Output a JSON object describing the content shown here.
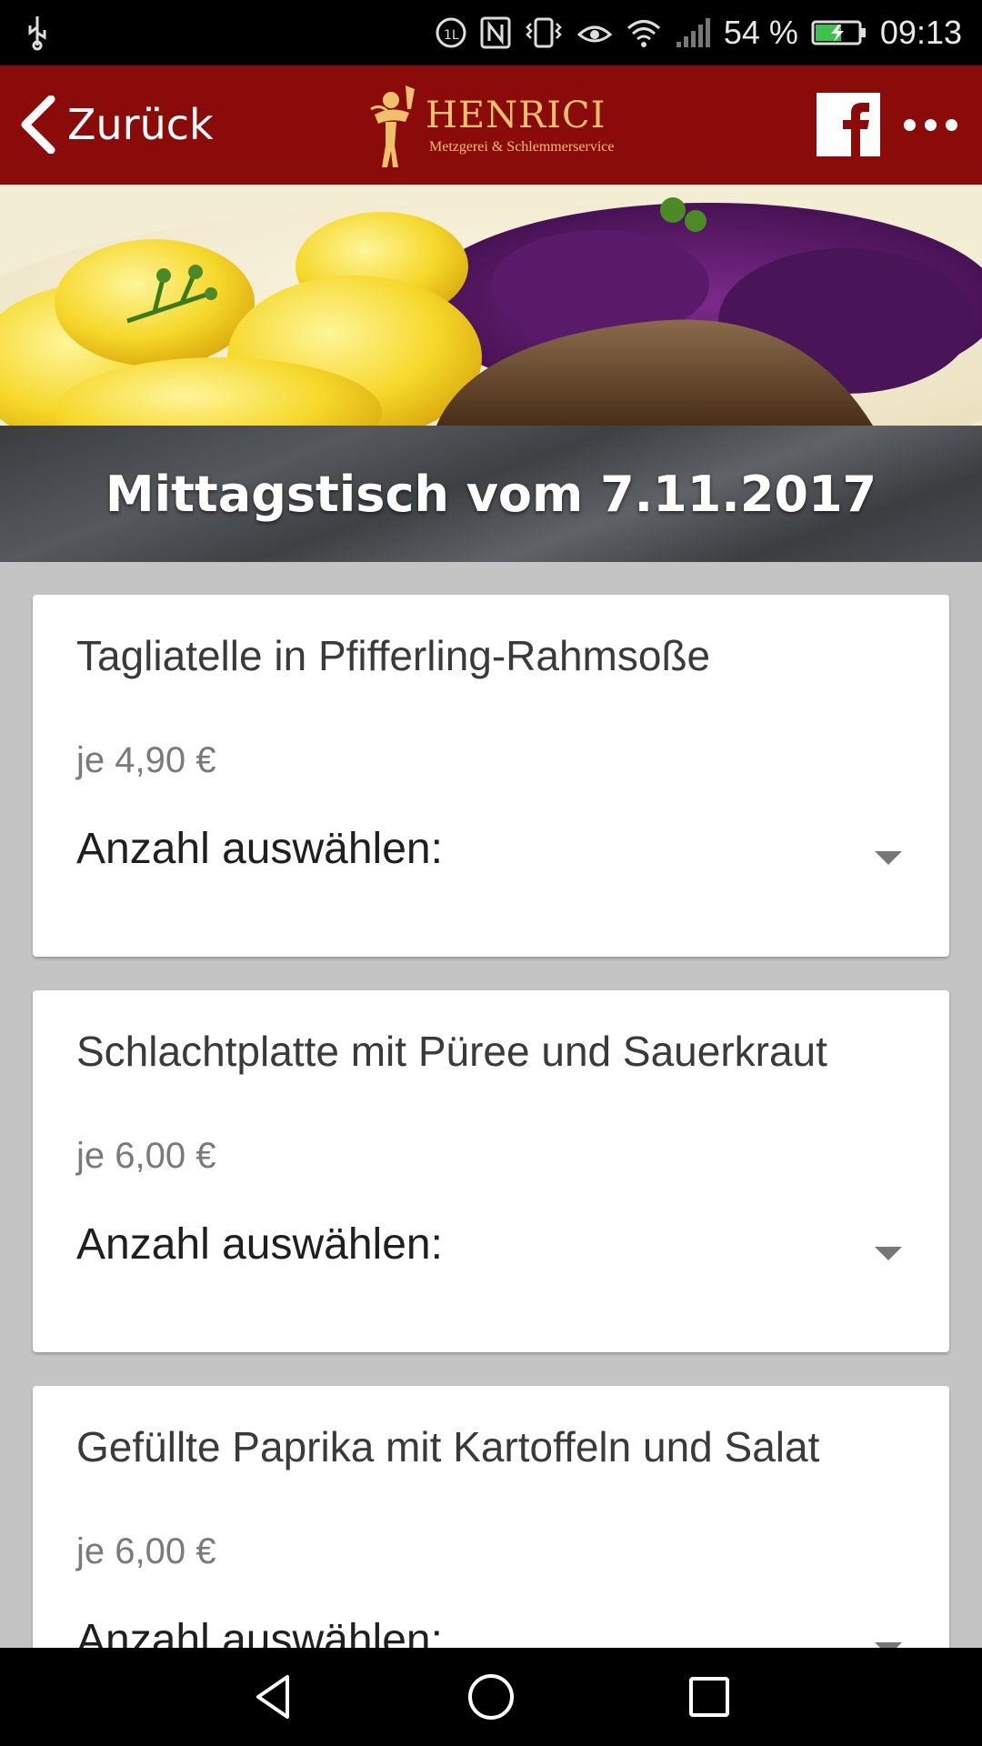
{
  "status_bar": {
    "battery_percent": "54 %",
    "time": "09:13",
    "icons": [
      "usb-icon",
      "data-saver-icon",
      "nfc-icon",
      "vibrate-icon",
      "eye-comfort-icon",
      "wifi-icon",
      "signal-icon",
      "battery-charging-icon"
    ]
  },
  "app_bar": {
    "back_label": "Zurück",
    "logo_name": "HENRICI",
    "logo_subtitle": "Metzgerei & Schlemmerservice",
    "facebook_icon": "facebook-icon",
    "more_icon": "more-horizontal-icon",
    "background_color": "#8b0b0b",
    "logo_color": "#f1c06b"
  },
  "banner": {
    "title": "Mittagstisch vom 7.11.2017"
  },
  "menu_items": [
    {
      "name": "Tagliatelle in Pfifferling-Rahmsoße",
      "price": "je 4,90 €",
      "select_label": "Anzahl auswählen:"
    },
    {
      "name": "Schlachtplatte mit Püree und Sauerkraut",
      "price": "je 6,00 €",
      "select_label": "Anzahl auswählen:"
    },
    {
      "name": "Gefüllte Paprika mit Kartoffeln und Salat",
      "price": "je 6,00 €",
      "select_label": "Anzahl auswählen:"
    }
  ],
  "nav_bar": {
    "icons": [
      "back-triangle-icon",
      "home-circle-icon",
      "recents-square-icon"
    ]
  }
}
